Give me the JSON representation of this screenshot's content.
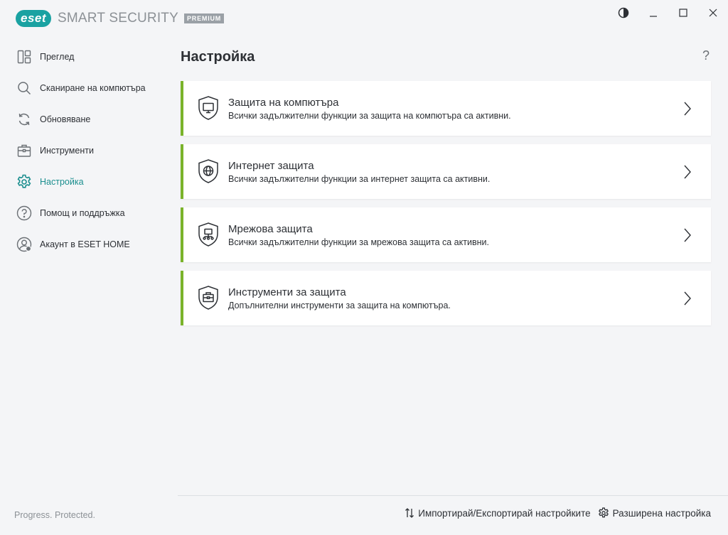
{
  "app": {
    "logo_text": "eset",
    "product": "SMART SECURITY",
    "tier": "PREMIUM",
    "tagline": "Progress. Protected."
  },
  "window_controls": [
    "theme-toggle-icon",
    "minimize-icon",
    "maximize-icon",
    "close-icon"
  ],
  "sidebar": {
    "items": [
      {
        "label": "Преглед",
        "icon": "dashboard-icon",
        "active": false
      },
      {
        "label": "Сканиране на компютъра",
        "icon": "search-icon",
        "active": false
      },
      {
        "label": "Обновяване",
        "icon": "refresh-icon",
        "active": false
      },
      {
        "label": "Инструменти",
        "icon": "toolbox-icon",
        "active": false
      },
      {
        "label": "Настройка",
        "icon": "gear-icon",
        "active": true
      },
      {
        "label": "Помощ и поддръжка",
        "icon": "help-icon",
        "active": false
      },
      {
        "label": "Акаунт в ESET HOME",
        "icon": "account-icon",
        "active": false
      }
    ]
  },
  "main": {
    "title": "Настройка",
    "help_label": "?",
    "cards": [
      {
        "title": "Защита на компютъра",
        "desc": "Всички задължителни функции за защита на компютъра са активни.",
        "icon": "computer-shield-icon"
      },
      {
        "title": "Интернет защита",
        "desc": "Всички задължителни функции за интернет защита са активни.",
        "icon": "globe-shield-icon"
      },
      {
        "title": "Мрежова защита",
        "desc": "Всички задължителни функции за мрежова защита са активни.",
        "icon": "network-shield-icon"
      },
      {
        "title": "Инструменти за защита",
        "desc": "Допълнителни инструменти за защита на компютъра.",
        "icon": "toolbox-shield-icon"
      }
    ]
  },
  "bottom": {
    "import_export": "Импортирай/Експортирай настройките",
    "advanced": "Разширена настройка"
  },
  "colors": {
    "accent": "#1a8e8e",
    "status_ok": "#7ab32a",
    "background": "#f4f5f7"
  }
}
